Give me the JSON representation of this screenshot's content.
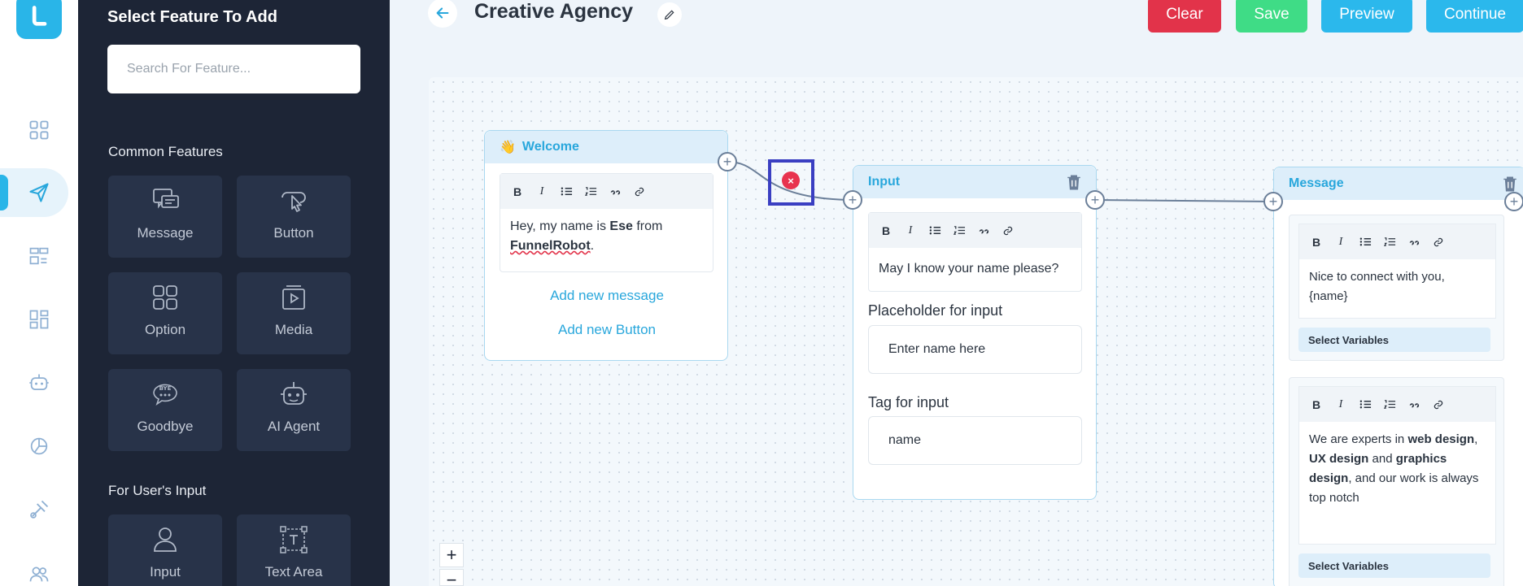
{
  "app": {
    "title": "Creative Agency"
  },
  "panel": {
    "title": "Select Feature To Add",
    "search_placeholder": "Search For Feature...",
    "common_label": "Common Features",
    "user_input_label": "For User's Input",
    "common_features": [
      {
        "label": "Message",
        "icon": "message-icon"
      },
      {
        "label": "Button",
        "icon": "button-click-icon"
      },
      {
        "label": "Option",
        "icon": "option-grid-icon"
      },
      {
        "label": "Media",
        "icon": "media-play-icon"
      },
      {
        "label": "Goodbye",
        "icon": "goodbye-bubble-icon"
      },
      {
        "label": "AI Agent",
        "icon": "robot-icon"
      }
    ],
    "input_features": [
      {
        "label": "Input",
        "icon": "user-icon"
      },
      {
        "label": "Text Area",
        "icon": "text-area-icon"
      }
    ]
  },
  "toolbar": {
    "clear": "Clear",
    "save": "Save",
    "preview": "Preview",
    "continue": "Continue"
  },
  "colors": {
    "clear": "#e2334a",
    "save": "#3fdc86",
    "preview": "#2bb8ec",
    "continue": "#2bb8ec",
    "accent": "#29a7dc"
  },
  "nodes": {
    "welcome": {
      "emoji": "👋",
      "title": "Welcome",
      "text_1": "Hey, my name is ",
      "text_bold_1": "Ese",
      "text_2": " from",
      "text_bold_2": "FunnelRobot",
      "text_3": ".",
      "add_message": "Add new message",
      "add_button": "Add new Button"
    },
    "input": {
      "title": "Input",
      "text": "May I know your name please?",
      "placeholder_label": "Placeholder for input",
      "placeholder_value": "Enter name here",
      "tag_label": "Tag for input",
      "tag_value": "name"
    },
    "message": {
      "title": "Message",
      "text_1": "Nice to connect with you, {name}",
      "select_variables": "Select Variables",
      "t2_a": "We are experts in ",
      "t2_b": "web design",
      "t2_c": ", ",
      "t2_d": "UX design",
      "t2_e": " and ",
      "t2_f": "graphics design",
      "t2_g": ", and our work is always top notch",
      "select_variables_2": "Select Variables"
    }
  },
  "editor_tools": [
    "B",
    "I"
  ],
  "zoom": {
    "in": "+",
    "out": "−"
  },
  "connection_delete": "×"
}
